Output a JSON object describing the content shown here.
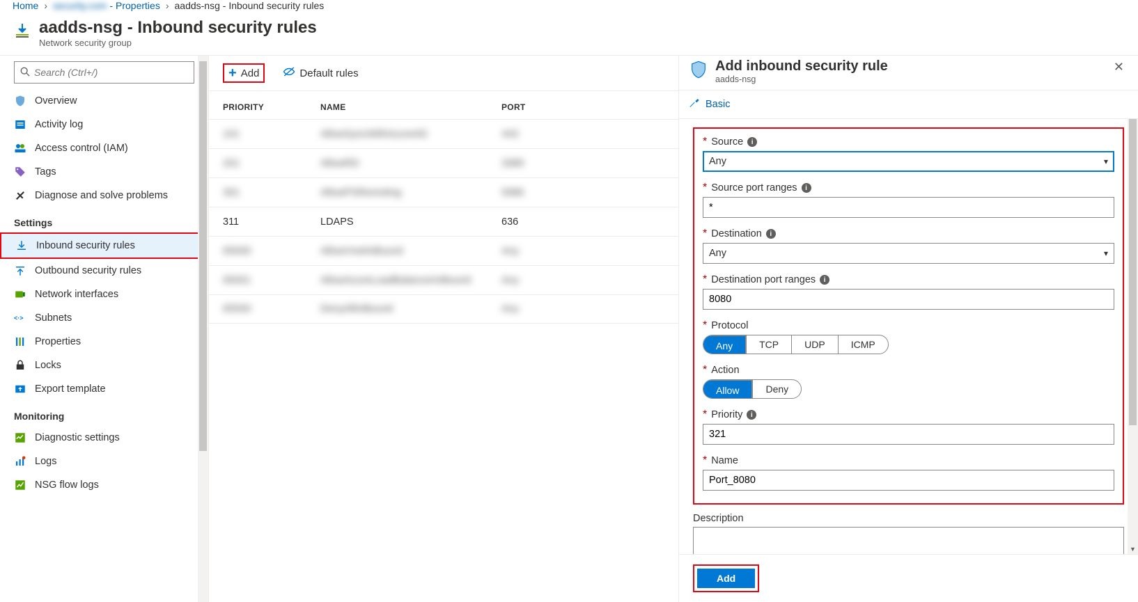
{
  "breadcrumbs": {
    "home": "Home",
    "redacted": "security.com",
    "properties_suffix": " - Properties",
    "last": "aadds-nsg - Inbound security rules"
  },
  "header": {
    "title": "aadds-nsg - Inbound security rules",
    "subtitle": "Network security group"
  },
  "sidebar": {
    "search_placeholder": "Search (Ctrl+/)",
    "items_top": [
      {
        "key": "overview",
        "label": "Overview"
      },
      {
        "key": "activity",
        "label": "Activity log"
      },
      {
        "key": "iam",
        "label": "Access control (IAM)"
      },
      {
        "key": "tags",
        "label": "Tags"
      },
      {
        "key": "diagnose",
        "label": "Diagnose and solve problems"
      }
    ],
    "section_settings": "Settings",
    "items_settings": [
      {
        "key": "inbound",
        "label": "Inbound security rules",
        "selected": true,
        "red": true
      },
      {
        "key": "outbound",
        "label": "Outbound security rules"
      },
      {
        "key": "nics",
        "label": "Network interfaces"
      },
      {
        "key": "subnets",
        "label": "Subnets"
      },
      {
        "key": "props",
        "label": "Properties"
      },
      {
        "key": "locks",
        "label": "Locks"
      },
      {
        "key": "export",
        "label": "Export template"
      }
    ],
    "section_monitoring": "Monitoring",
    "items_monitoring": [
      {
        "key": "diag",
        "label": "Diagnostic settings"
      },
      {
        "key": "logs",
        "label": "Logs"
      },
      {
        "key": "nsgflow",
        "label": "NSG flow logs"
      }
    ]
  },
  "toolbar": {
    "add": "Add",
    "default_rules": "Default rules"
  },
  "table": {
    "headers": {
      "priority": "PRIORITY",
      "name": "NAME",
      "port": "PORT"
    },
    "rows": [
      {
        "priority": "101",
        "name": "AllowSyncWithAzureAD",
        "port": "443",
        "blur": true
      },
      {
        "priority": "201",
        "name": "AllowRD",
        "port": "3389",
        "blur": true
      },
      {
        "priority": "301",
        "name": "AllowPSRemoting",
        "port": "5986",
        "blur": true
      },
      {
        "priority": "311",
        "name": "LDAPS",
        "port": "636",
        "blur": false
      },
      {
        "priority": "65000",
        "name": "AllowVnetInBound",
        "port": "Any",
        "blur": true
      },
      {
        "priority": "65001",
        "name": "AllowAzureLoadBalancerInBound",
        "port": "Any",
        "blur": true
      },
      {
        "priority": "65500",
        "name": "DenyAllInBound",
        "port": "Any",
        "blur": true
      }
    ]
  },
  "panel": {
    "title": "Add inbound security rule",
    "subtitle": "aadds-nsg",
    "basic": "Basic",
    "fields": {
      "source": {
        "label": "Source",
        "value": "Any"
      },
      "src_port": {
        "label": "Source port ranges",
        "value": "*"
      },
      "destination": {
        "label": "Destination",
        "value": "Any"
      },
      "dst_port": {
        "label": "Destination port ranges",
        "value": "8080"
      },
      "protocol": {
        "label": "Protocol",
        "options": [
          "Any",
          "TCP",
          "UDP",
          "ICMP"
        ],
        "selected": "Any"
      },
      "action": {
        "label": "Action",
        "options": [
          "Allow",
          "Deny"
        ],
        "selected": "Allow"
      },
      "priority": {
        "label": "Priority",
        "value": "321"
      },
      "name": {
        "label": "Name",
        "value": "Port_8080"
      },
      "description": {
        "label": "Description",
        "value": ""
      }
    },
    "add_button": "Add"
  }
}
